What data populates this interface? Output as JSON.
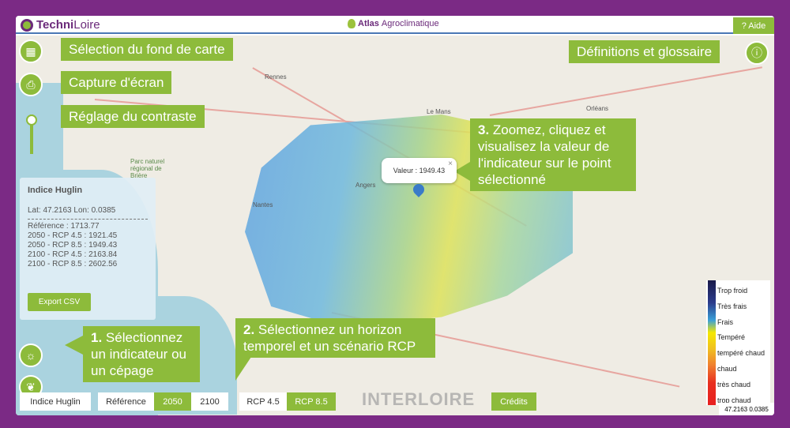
{
  "header": {
    "brand_bold": "Techni",
    "brand_rest": "Loire",
    "atlas_bold": "Atlas",
    "atlas_rest": "Agroclimatique",
    "help": "? Aide"
  },
  "callouts": {
    "basemap": "Sélection du fond de carte",
    "capture": "Capture d'écran",
    "contrast": "Réglage du contraste",
    "glossary": "Définitions et glossaire",
    "step1_num": "1.",
    "step1": "Sélectionnez un indicateur ou un cépage",
    "step2_num": "2.",
    "step2": "Sélectionnez un horizon temporel et un scénario RCP",
    "step3_num": "3.",
    "step3": "Zoomez, cliquez et visualisez la valeur de l'indicateur sur le point sélectionné"
  },
  "info": {
    "title": "Indice Huglin",
    "latlon": "Lat: 47.2163 Lon: 0.0385",
    "rows": [
      "Référence : 1713.77",
      "2050 - RCP 4.5 : 1921.45",
      "2050 - RCP 8.5 : 1949.43",
      "2100 - RCP 4.5 : 2163.84",
      "2100 - RCP 8.5 : 2602.56"
    ],
    "export": "Export CSV"
  },
  "popup": {
    "value": "Valeur : 1949.43",
    "close": "×"
  },
  "legend": [
    "Trop froid",
    "Très frais",
    "Frais",
    "Tempéré",
    "tempéré chaud",
    "chaud",
    "très chaud",
    "trop chaud"
  ],
  "coords": "47.2163 0.0385",
  "bottom": {
    "indicator": "Indice Huglin",
    "horizons": [
      "Référence",
      "2050",
      "2100"
    ],
    "selected_horizon": "2050",
    "scenarios": [
      "RCP 4.5",
      "RCP 8.5"
    ],
    "selected_scenario": "RCP 8.5",
    "credits": "Crédits",
    "partner": "INTERLOIRE"
  },
  "map_labels": [
    "Rennes",
    "Nantes",
    "Angers",
    "Le Mans",
    "Orléans",
    "Parc naturel régional de Brière"
  ],
  "colors": {
    "accent": "#8dbb3b",
    "frame": "#7b2a85"
  }
}
